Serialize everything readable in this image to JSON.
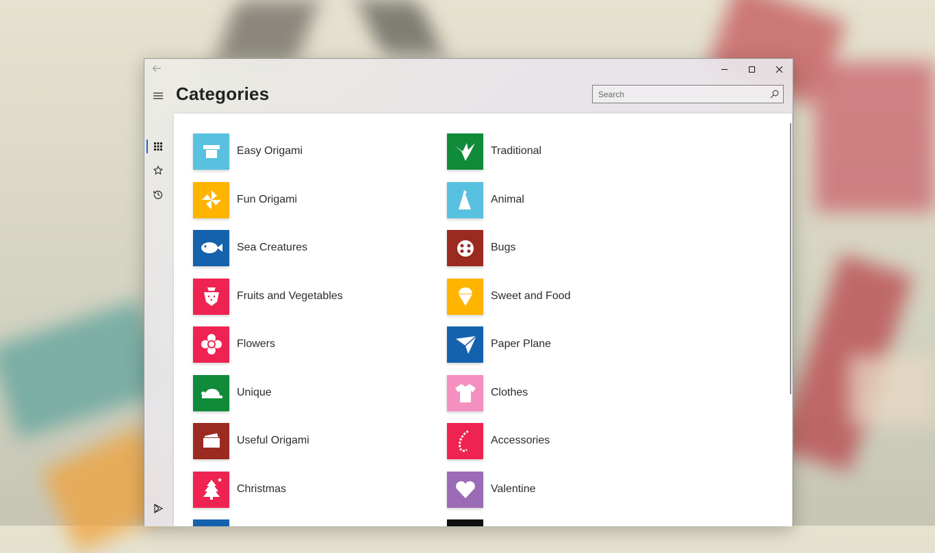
{
  "window": {
    "back_icon": "back-arrow-icon",
    "controls": [
      "minimize-icon",
      "maximize-icon",
      "close-icon"
    ]
  },
  "sidebar": {
    "items": [
      {
        "icon": "hamburger-menu-icon"
      },
      {
        "icon": "grid-icon",
        "selected": true
      },
      {
        "icon": "star-icon"
      },
      {
        "icon": "history-icon"
      },
      {
        "icon": "play-store-icon"
      },
      {
        "icon": "info-icon"
      }
    ],
    "accent": "#1e5fd6"
  },
  "header": {
    "title": "Categories"
  },
  "search": {
    "placeholder": "Search",
    "value": ""
  },
  "categories": [
    {
      "label": "Easy Origami",
      "color": "#58c1df",
      "icon": "box-icon"
    },
    {
      "label": "Traditional",
      "color": "#0f8b3a",
      "icon": "crane-icon"
    },
    {
      "label": "Fun Origami",
      "color": "#ffb400",
      "icon": "pinwheel-icon"
    },
    {
      "label": "Animal",
      "color": "#58c1df",
      "icon": "penguin-icon"
    },
    {
      "label": "Sea Creatures",
      "color": "#1462ad",
      "icon": "fish-icon"
    },
    {
      "label": "Bugs",
      "color": "#9b2a20",
      "icon": "ladybug-icon"
    },
    {
      "label": "Fruits and Vegetables",
      "color": "#ef2351",
      "icon": "strawberry-icon"
    },
    {
      "label": "Sweet and Food",
      "color": "#ffb400",
      "icon": "ice-cream-icon"
    },
    {
      "label": "Flowers",
      "color": "#ef2351",
      "icon": "flower-icon"
    },
    {
      "label": "Paper Plane",
      "color": "#1462ad",
      "icon": "paper-plane-icon"
    },
    {
      "label": "Unique",
      "color": "#0f8b3a",
      "icon": "turtle-icon"
    },
    {
      "label": "Clothes",
      "color": "#f58fbf",
      "icon": "shirt-icon"
    },
    {
      "label": "Useful Origami",
      "color": "#9b2a20",
      "icon": "wallet-icon"
    },
    {
      "label": "Accessories",
      "color": "#ef2351",
      "icon": "necklace-icon"
    },
    {
      "label": "Christmas",
      "color": "#ef2351",
      "icon": "christmas-tree-icon"
    },
    {
      "label": "Valentine",
      "color": "#9b6bb6",
      "icon": "heart-icon"
    },
    {
      "label": "",
      "color": "#1462ad",
      "icon": "partial-tile-icon"
    },
    {
      "label": "",
      "color": "#111111",
      "icon": "partial-tile-icon"
    }
  ]
}
